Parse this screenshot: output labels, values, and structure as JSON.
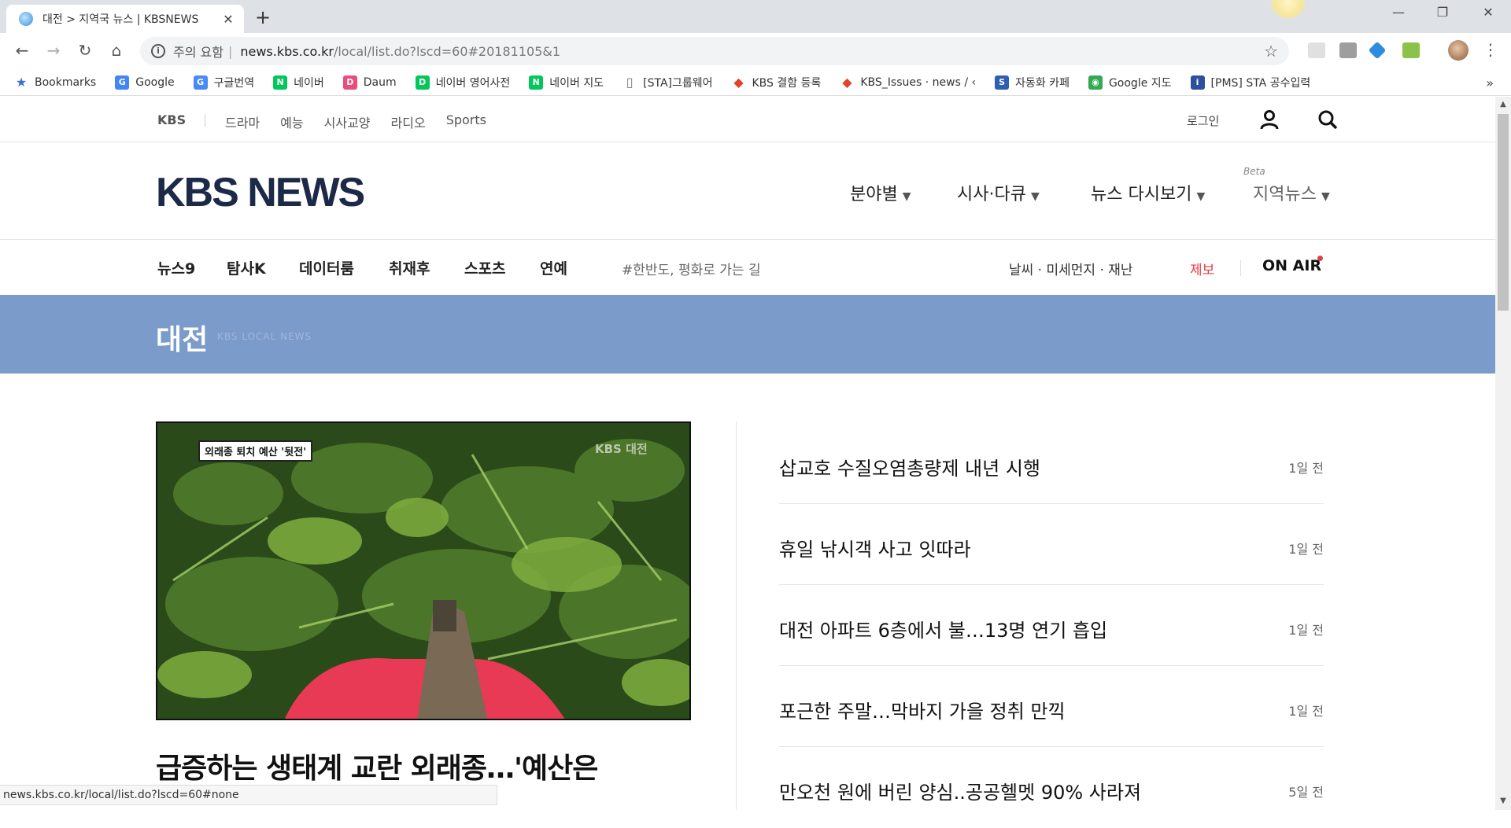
{
  "browser": {
    "tab_title": "대전 > 지역국 뉴스 | KBSNEWS",
    "tab_close": "✕",
    "new_tab": "+",
    "security_label": "주의 요함",
    "url_host": "news.kbs.co.kr",
    "url_path": "/local/list.do?lscd=60#20181105&1",
    "status_url": "news.kbs.co.kr/local/list.do?lscd=60#none",
    "bookmarks": [
      {
        "label": "Bookmarks",
        "icon": "star-icon",
        "color": "#3b6fd8"
      },
      {
        "label": "Google",
        "icon": "google-icon",
        "color": "#4285f4"
      },
      {
        "label": "구글번역",
        "icon": "translate-icon",
        "color": "#4a8af4"
      },
      {
        "label": "네이버",
        "icon": "naver-icon",
        "color": "#03c75a"
      },
      {
        "label": "Daum",
        "icon": "daum-icon",
        "color": "#e84e7c"
      },
      {
        "label": "네이버 영어사전",
        "icon": "dict-icon",
        "color": "#03c75a"
      },
      {
        "label": "네이버 지도",
        "icon": "naver-icon",
        "color": "#03c75a"
      },
      {
        "label": "[STA]그룹웨어",
        "icon": "page-icon",
        "color": "#777777"
      },
      {
        "label": "KBS 결함 등록",
        "icon": "gitlab-icon",
        "color": "#e24329"
      },
      {
        "label": "KBS_Issues · news / ‹",
        "icon": "gitlab-icon",
        "color": "#e24329"
      },
      {
        "label": "자동화 카페",
        "icon": "cafe-icon",
        "color": "#2f5fb3"
      },
      {
        "label": "Google 지도",
        "icon": "maps-icon",
        "color": "#34a853"
      },
      {
        "label": "[PMS] STA 공수입력",
        "icon": "pms-icon",
        "color": "#2c4f9e"
      }
    ],
    "bookmarks_more": "»"
  },
  "site": {
    "top_brand": "KBS",
    "top_links": [
      "드라마",
      "예능",
      "시사교양",
      "라디오",
      "Sports"
    ],
    "login": "로그인",
    "logo": "KBS NEWS",
    "menu": {
      "by_field": "분야별",
      "docu": "시사·다큐",
      "replay": "뉴스 다시보기",
      "local": "지역뉴스",
      "beta": "Beta"
    },
    "subnav": [
      "뉴스9",
      "탐사K",
      "데이터룸",
      "취재후",
      "스포츠",
      "연예"
    ],
    "hashtag": "#한반도, 평화로 가는 길",
    "weather": "날씨 · 미세먼지 · 재난",
    "report": "제보",
    "onair": "ON AIR",
    "banner_region": "대전",
    "banner_sub": "KBS LOCAL NEWS"
  },
  "feature": {
    "caption": "외래종 퇴치 예산 '뒷전'",
    "watermark": "KBS 대전",
    "headline": "급증하는 생태계 교란 외래종…'예산은"
  },
  "news": [
    {
      "title": "삽교호 수질오염총량제 내년 시행",
      "date": "1일 전"
    },
    {
      "title": "휴일 낚시객 사고 잇따라",
      "date": "1일 전"
    },
    {
      "title": "대전 아파트 6층에서 불…13명 연기 흡입",
      "date": "1일 전"
    },
    {
      "title": "포근한 주말…막바지 가을 정취 만끽",
      "date": "1일 전"
    },
    {
      "title": "만오천 원에 버린 양심..공공헬멧 90% 사라져",
      "date": "5일 전"
    }
  ]
}
